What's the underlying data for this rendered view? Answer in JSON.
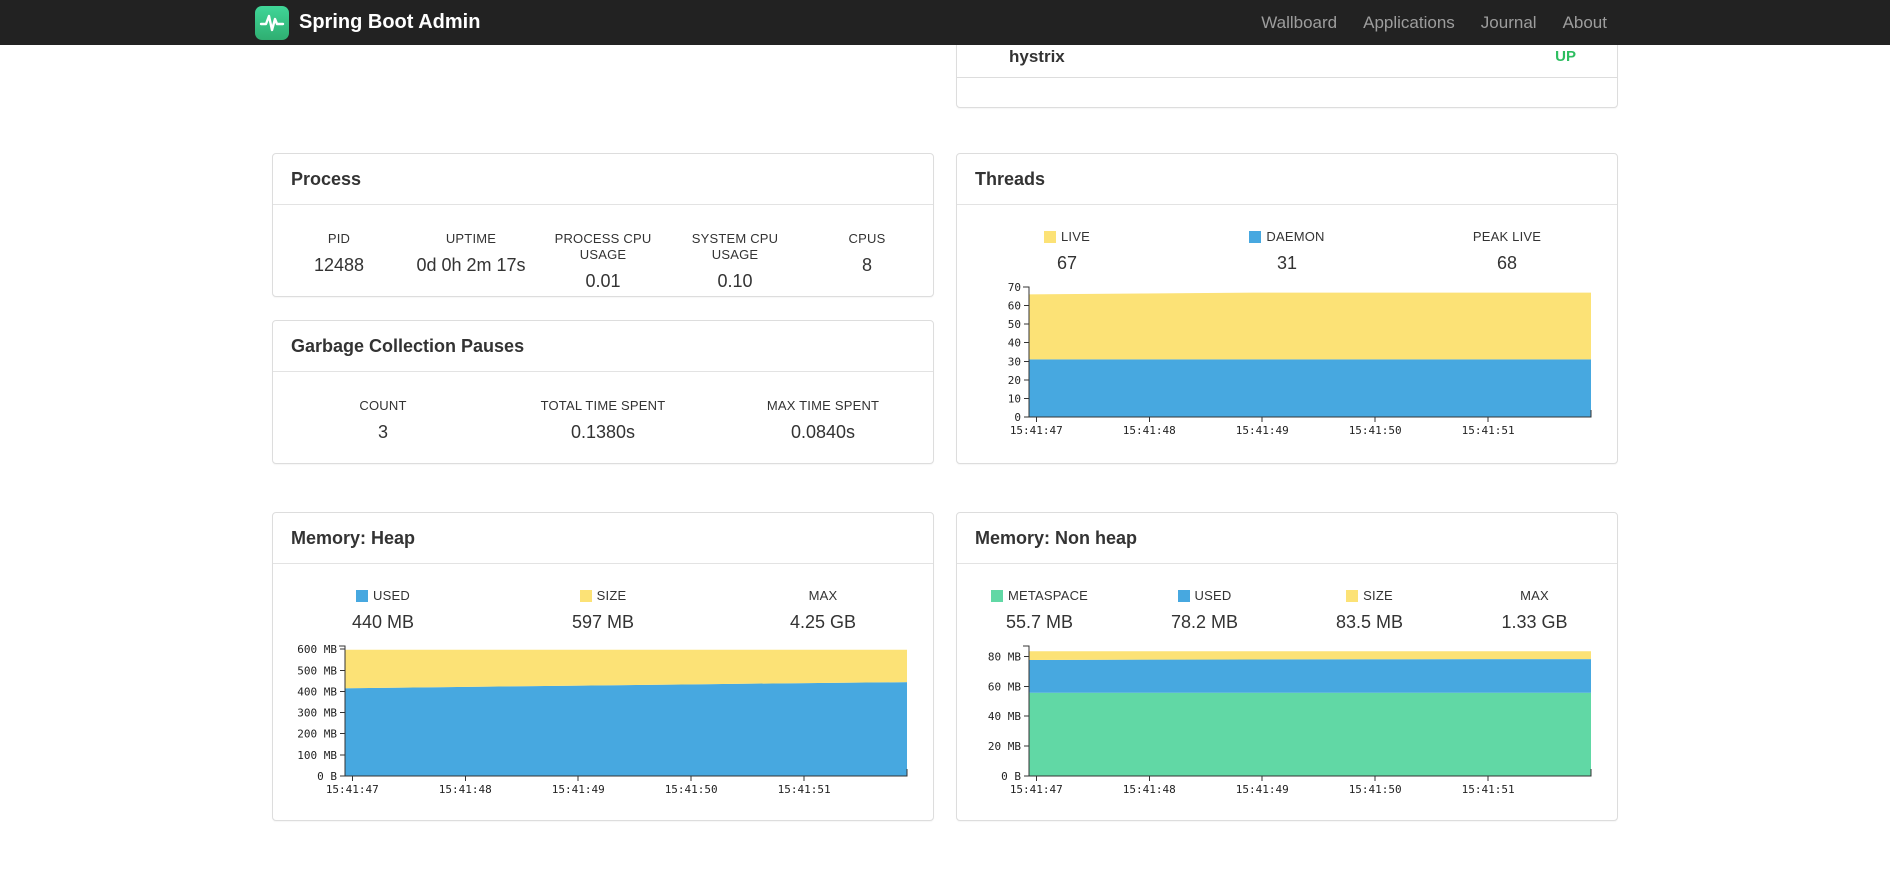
{
  "navbar": {
    "brand": "Spring Boot Admin",
    "items": [
      {
        "label": "Wallboard"
      },
      {
        "label": "Applications"
      },
      {
        "label": "Journal"
      },
      {
        "label": "About"
      }
    ]
  },
  "applications": {
    "name": "hystrix",
    "status": "UP",
    "status_color": "#2dbe60"
  },
  "cards": {
    "process": {
      "title": "Process",
      "stats": [
        {
          "label": "PID",
          "value": "12488"
        },
        {
          "label": "UPTIME",
          "value": "0d 0h 2m 17s"
        },
        {
          "label": "PROCESS CPU USAGE",
          "value": "0.01"
        },
        {
          "label": "SYSTEM CPU USAGE",
          "value": "0.10"
        },
        {
          "label": "CPUS",
          "value": "8"
        }
      ]
    },
    "gc": {
      "title": "Garbage Collection Pauses",
      "stats": [
        {
          "label": "COUNT",
          "value": "3"
        },
        {
          "label": "TOTAL TIME SPENT",
          "value": "0.1380s"
        },
        {
          "label": "MAX TIME SPENT",
          "value": "0.0840s"
        }
      ]
    },
    "threads": {
      "title": "Threads",
      "legend": [
        {
          "label": "LIVE",
          "value": "67",
          "color": "#fce276"
        },
        {
          "label": "DAEMON",
          "value": "31",
          "color": "#47a8e0"
        },
        {
          "label": "PEAK LIVE",
          "value": "68",
          "color": null
        }
      ],
      "chart": {
        "type": "area",
        "y_max": 70,
        "y_ticks": [
          {
            "v": 70,
            "label": "70"
          },
          {
            "v": 60,
            "label": "60"
          },
          {
            "v": 50,
            "label": "50"
          },
          {
            "v": 40,
            "label": "40"
          },
          {
            "v": 30,
            "label": "30"
          },
          {
            "v": 20,
            "label": "20"
          },
          {
            "v": 10,
            "label": "10"
          },
          {
            "v": 0,
            "label": "0"
          }
        ],
        "x_labels": [
          "15:41:47",
          "15:41:48",
          "15:41:49",
          "15:41:50",
          "15:41:51"
        ],
        "layers": [
          {
            "name": "DAEMON",
            "color": "#47a8e0",
            "values": [
              31,
              31,
              31,
              31,
              31,
              31
            ]
          },
          {
            "name": "LIVE",
            "color": "#fce276",
            "values": [
              66,
              66.5,
              67,
              67,
              67,
              67
            ]
          }
        ]
      }
    },
    "heap": {
      "title": "Memory: Heap",
      "legend": [
        {
          "label": "USED",
          "value": "440 MB",
          "color": "#47a8e0"
        },
        {
          "label": "SIZE",
          "value": "597 MB",
          "color": "#fce276"
        },
        {
          "label": "MAX",
          "value": "4.25 GB",
          "color": null
        }
      ],
      "chart": {
        "type": "area",
        "y_max": 615,
        "y_ticks": [
          {
            "v": 600,
            "label": "600 MB"
          },
          {
            "v": 500,
            "label": "500 MB"
          },
          {
            "v": 400,
            "label": "400 MB"
          },
          {
            "v": 300,
            "label": "300 MB"
          },
          {
            "v": 200,
            "label": "200 MB"
          },
          {
            "v": 100,
            "label": "100 MB"
          },
          {
            "v": 0,
            "label": "0 B"
          }
        ],
        "x_labels": [
          "15:41:47",
          "15:41:48",
          "15:41:49",
          "15:41:50",
          "15:41:51"
        ],
        "layers": [
          {
            "name": "USED",
            "color": "#47a8e0",
            "values": [
              415,
              421,
              427,
              433,
              439,
              444
            ]
          },
          {
            "name": "SIZE",
            "color": "#fce276",
            "values": [
              597,
              597,
              597,
              597,
              597,
              597
            ]
          }
        ]
      }
    },
    "nonheap": {
      "title": "Memory: Non heap",
      "legend": [
        {
          "label": "METASPACE",
          "value": "55.7 MB",
          "color": "#61d8a5"
        },
        {
          "label": "USED",
          "value": "78.2 MB",
          "color": "#47a8e0"
        },
        {
          "label": "SIZE",
          "value": "83.5 MB",
          "color": "#fce276"
        },
        {
          "label": "MAX",
          "value": "1.33 GB",
          "color": null
        }
      ],
      "chart": {
        "type": "area",
        "y_max": 87,
        "y_ticks": [
          {
            "v": 80,
            "label": "80 MB"
          },
          {
            "v": 60,
            "label": "60 MB"
          },
          {
            "v": 40,
            "label": "40 MB"
          },
          {
            "v": 20,
            "label": "20 MB"
          },
          {
            "v": 0,
            "label": "0 B"
          }
        ],
        "x_labels": [
          "15:41:47",
          "15:41:48",
          "15:41:49",
          "15:41:50",
          "15:41:51"
        ],
        "layers": [
          {
            "name": "METASPACE",
            "color": "#61d8a5",
            "values": [
              55.7,
              55.7,
              55.7,
              55.7,
              55.7,
              55.7
            ]
          },
          {
            "name": "USED",
            "color": "#47a8e0",
            "values": [
              77.6,
              77.9,
              78,
              78.1,
              78.2,
              78.2
            ]
          },
          {
            "name": "SIZE",
            "color": "#fce276",
            "values": [
              83.5,
              83.5,
              83.5,
              83.5,
              83.5,
              83.5
            ]
          }
        ]
      }
    }
  }
}
